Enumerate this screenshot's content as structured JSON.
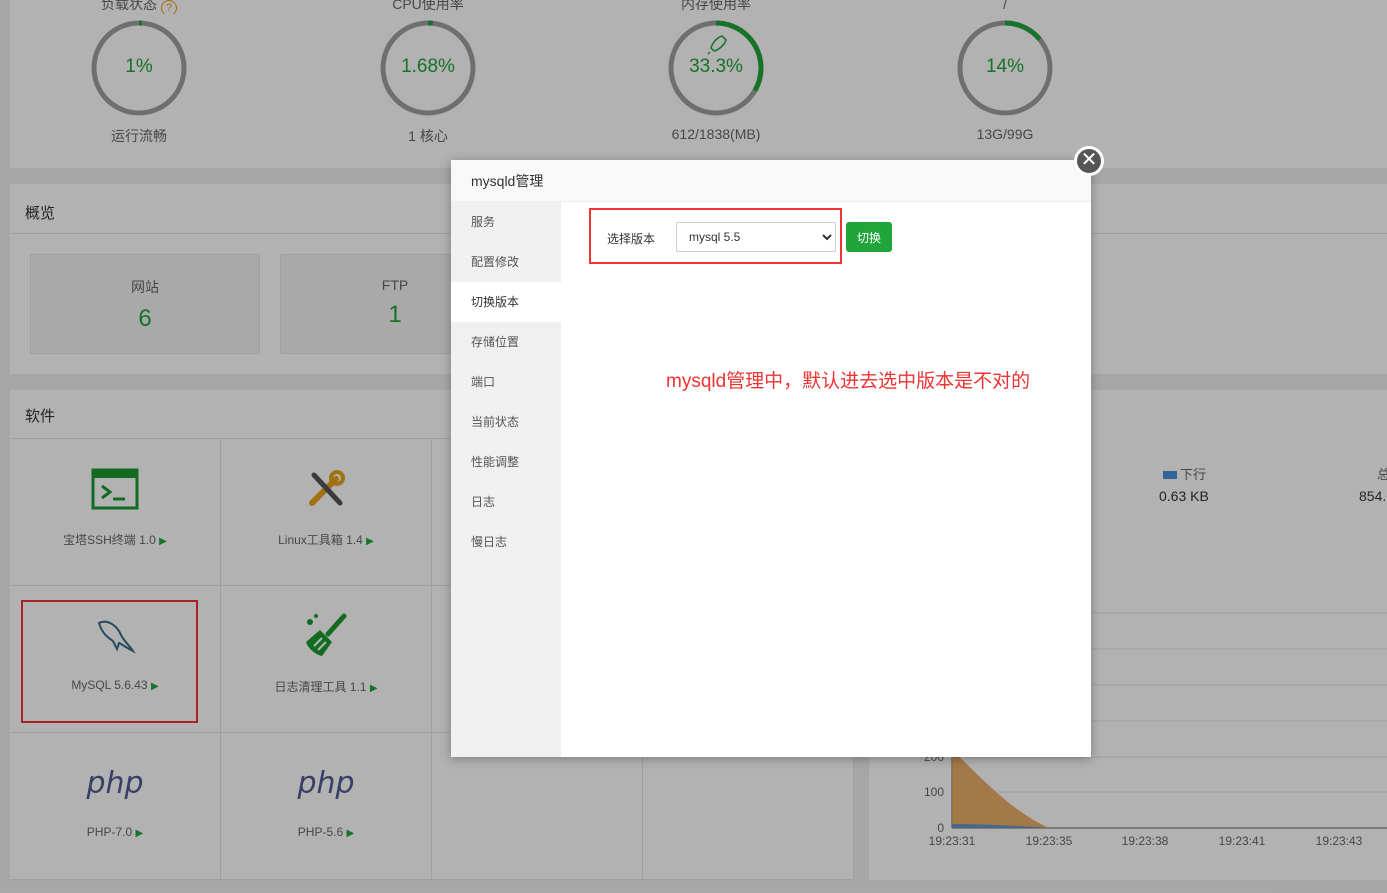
{
  "status": {
    "items": [
      {
        "title": "负载状态",
        "value": "1%",
        "sub": "运行流畅",
        "percent": 1,
        "has_help": true
      },
      {
        "title": "CPU使用率",
        "value": "1.68%",
        "sub": "1 核心",
        "percent": 1.68
      },
      {
        "title": "内存使用率",
        "value": "33.3%",
        "sub": "612/1838(MB)",
        "percent": 33.3,
        "has_rocket": true
      },
      {
        "title": "/",
        "value": "14%",
        "sub": "13G/99G",
        "percent": 14
      }
    ],
    "help_glyph": "?"
  },
  "overview": {
    "title": "概览",
    "boxes": [
      {
        "label": "网站",
        "value": "6"
      },
      {
        "label": "FTP",
        "value": "1"
      }
    ]
  },
  "software": {
    "title": "软件",
    "items": [
      {
        "label": "宝塔SSH终端 1.0",
        "icon": "terminal-icon"
      },
      {
        "label": "Linux工具箱 1.4",
        "icon": "tools-icon"
      },
      {
        "label": "MySQL 5.6.43",
        "icon": "mysql-dolphin-icon"
      },
      {
        "label": "日志清理工具 1.1",
        "icon": "broom-icon"
      },
      {
        "label": "PHP-7.0",
        "icon": "php-icon"
      },
      {
        "label": "PHP-5.6",
        "icon": "php-icon"
      }
    ],
    "play_glyph": "▶",
    "php_text": "php"
  },
  "traffic": {
    "down_label": "下行",
    "down_value": "0.63 KB",
    "total_label": "总",
    "total_value": "854.",
    "y_ticks": [
      "200",
      "100",
      "0"
    ],
    "x_ticks": [
      "19:23:31",
      "19:23:35",
      "19:23:38",
      "19:23:41",
      "19:23:43"
    ]
  },
  "modal": {
    "title": "mysqld管理",
    "close_glyph": "✕",
    "menu": [
      "服务",
      "配置修改",
      "切换版本",
      "存储位置",
      "端口",
      "当前状态",
      "性能调整",
      "日志",
      "慢日志"
    ],
    "active_index": 2,
    "version_label": "选择版本",
    "version_selected": "mysql 5.5",
    "switch_button": "切换",
    "annotation": "mysqld管理中，默认进去选中版本是不对的"
  },
  "colors": {
    "accent": "#20a53a",
    "annotation": "#ee3333",
    "ring_track": "#a0a0a0"
  }
}
